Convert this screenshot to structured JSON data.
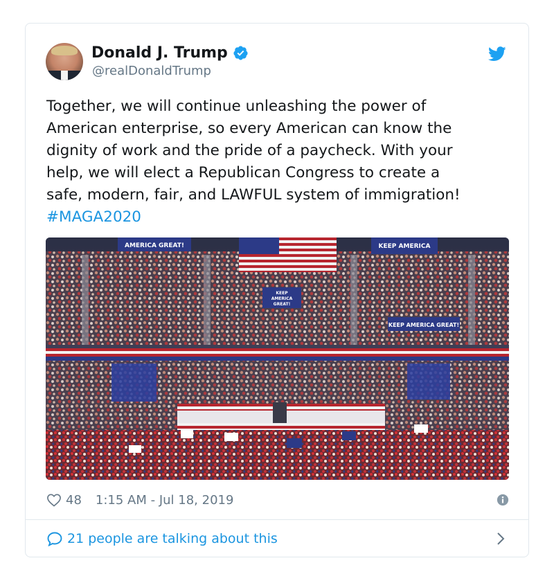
{
  "author": {
    "name": "Donald J. Trump",
    "handle": "@realDonaldTrump",
    "verified_icon": "verified-badge-icon",
    "avatar_icon": "profile-avatar"
  },
  "tweet": {
    "text": "Together, we will continue unleashing the power of\nAmerican enterprise, so every American can know the\ndignity of work and the pride of a paycheck. With your\nhelp, we will elect a Republican Congress to create a\nsafe, modern, fair, and LAWFUL system of immigration!",
    "hashtag": "#MAGA2020"
  },
  "media": {
    "banner_left": "AMERICA GREAT!",
    "banner_top_right": "KEEP AMERICA",
    "banner_center": "KEEP\nAMERICA\nGREAT!",
    "banner_right": "KEEP AMERICA GREAT!"
  },
  "footer": {
    "likes": "48",
    "timestamp": "1:15 AM - Jul 18, 2019",
    "talking": "21 people are talking about this"
  },
  "colors": {
    "link": "#1b95e0",
    "muted": "#657786",
    "text": "#14171a",
    "verified": "#1da1f2"
  },
  "icons": [
    "twitter-bird-icon",
    "heart-icon",
    "info-icon",
    "comment-bubble-icon",
    "chevron-right-icon"
  ]
}
